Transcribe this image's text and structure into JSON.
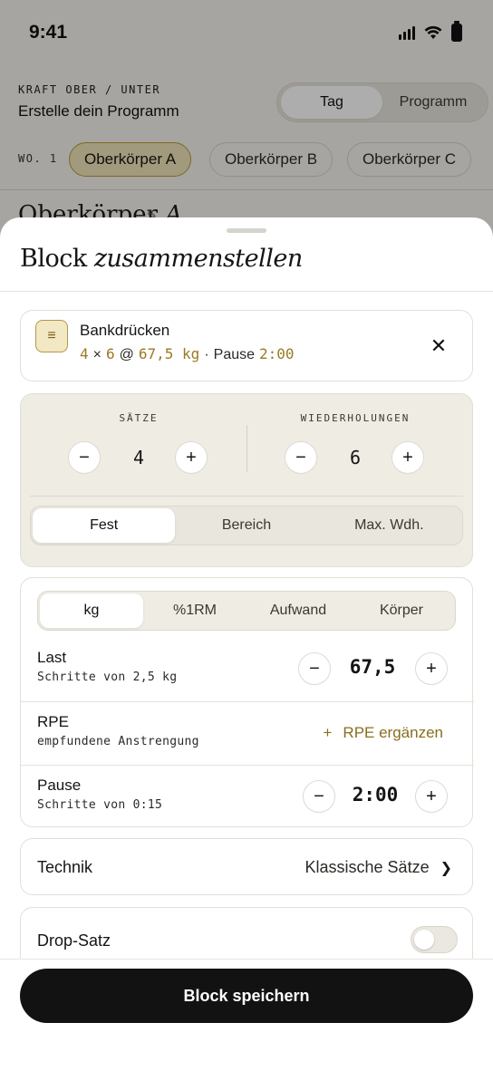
{
  "status_bar": {
    "time": "9:41",
    "icons": [
      "signal-icon",
      "wifi-icon",
      "battery-icon"
    ]
  },
  "header": {
    "kicker": "KRAFT OBER / UNTER",
    "title": "Erstelle dein Programm",
    "view_toggle": [
      {
        "label": "Tag",
        "active": true
      },
      {
        "label": "Programm",
        "active": false
      }
    ]
  },
  "days": {
    "week_label": "WO. 1",
    "items": [
      {
        "label": "Oberkörper A",
        "active": true
      },
      {
        "label": "Oberkörper B",
        "active": false
      },
      {
        "label": "Oberkörper C",
        "active": false
      }
    ]
  },
  "peek": {
    "title_main": "Oberkörper",
    "title_italic": "A"
  },
  "sheet": {
    "title_main": "Block",
    "title_italic": "zusammenstellen",
    "exercise": {
      "name": "Bankdrücken",
      "sets": "4",
      "times": "×",
      "reps": "6",
      "at": "@",
      "load": "67,5 kg",
      "sep": "·",
      "pause_label": "Pause",
      "pause": "2:00"
    },
    "sets_reps": {
      "sets_label": "SÄTZE",
      "sets_value": "4",
      "reps_label": "WIEDERHOLUNGEN",
      "reps_value": "6",
      "mode_options": [
        {
          "label": "Fest",
          "active": true
        },
        {
          "label": "Bereich",
          "active": false
        },
        {
          "label": "Max. Wdh.",
          "active": false
        }
      ]
    },
    "load": {
      "unit_options": [
        {
          "label": "kg",
          "active": true
        },
        {
          "label": "%1RM",
          "active": false
        },
        {
          "label": "Aufwand",
          "active": false
        },
        {
          "label": "Körper",
          "active": false
        }
      ],
      "last_title": "Last",
      "last_sub": "Schritte von 2,5 kg",
      "last_value": "67,5",
      "rpe_title": "RPE",
      "rpe_sub": "empfundene Anstrengung",
      "rpe_add_plus": "+",
      "rpe_add_label": "RPE ergänzen",
      "pause_title": "Pause",
      "pause_sub": "Schritte von 0:15",
      "pause_value": "2:00"
    },
    "technique": {
      "label": "Technik",
      "value": "Klassische Sätze"
    },
    "drop_set": {
      "label": "Drop-Satz",
      "enabled": false
    },
    "save_label": "Block speichern"
  },
  "stepper_minus": "−",
  "stepper_plus": "+",
  "colors": {
    "accent": "#9a7a22",
    "accent_bg": "#efe3b8",
    "primary_button": "#121212",
    "panel": "#efece4"
  }
}
